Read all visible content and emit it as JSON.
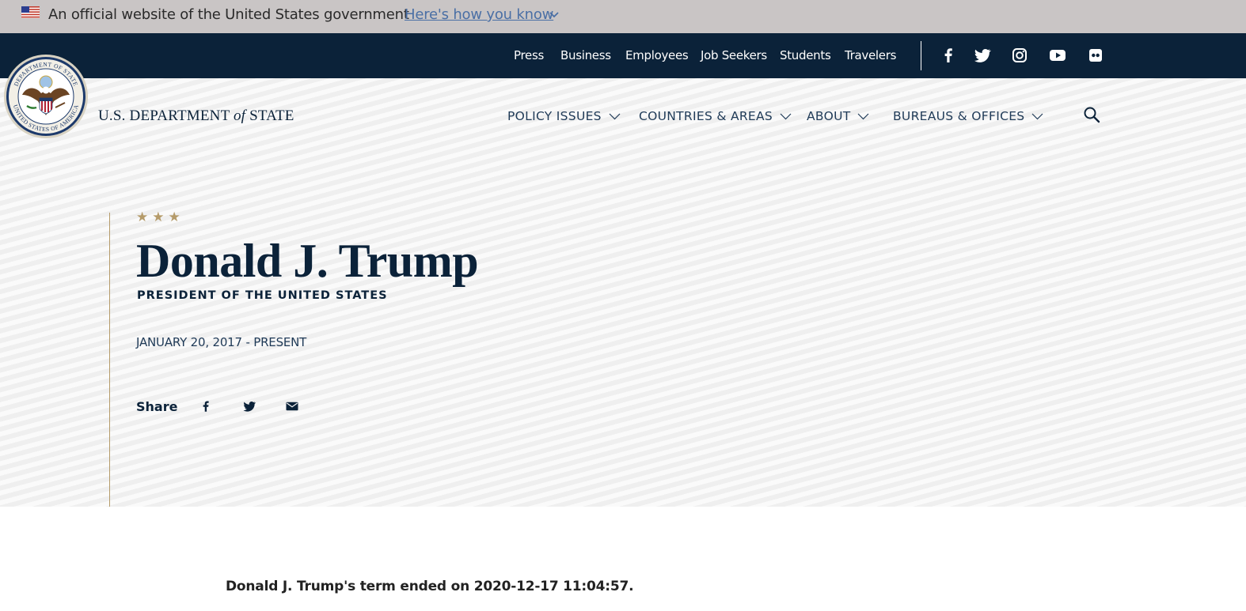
{
  "gov_banner": {
    "text": "An official website of the United States government",
    "link_text": "Here's how you know",
    "flag_icon": "us-flag-icon",
    "chevron_icon": "chevron-down-icon"
  },
  "utility_nav": {
    "links": [
      "Press",
      "Business",
      "Employees",
      "Job Seekers",
      "Students",
      "Travelers"
    ],
    "social_icons": [
      "facebook-icon",
      "twitter-icon",
      "instagram-icon",
      "youtube-icon",
      "flickr-icon"
    ]
  },
  "header": {
    "wordmark_prefix": "U.S. DEPARTMENT",
    "wordmark_of": "of",
    "wordmark_suffix": "STATE",
    "seal_text_top": "DEPARTMENT OF STATE",
    "seal_text_bottom": "UNITED STATES OF AMERICA",
    "nav": [
      "POLICY ISSUES",
      "COUNTRIES & AREAS",
      "ABOUT",
      "BUREAUS & OFFICES"
    ],
    "search_icon": "search-icon"
  },
  "hero": {
    "stars": "★★★",
    "title": "Donald J. Trump",
    "subtitle": "PRESIDENT OF THE UNITED STATES",
    "dates": "JANUARY 20, 2017 - PRESENT",
    "share_label": "Share",
    "share_icons": [
      "facebook-icon",
      "twitter-icon",
      "email-icon"
    ]
  },
  "body": {
    "term_text": "Donald J. Trump's term ended on 2020-12-17 11:04:57."
  },
  "colors": {
    "navy": "#0b2239",
    "gold": "#b59b6a",
    "banner_gray": "#c9c5c5",
    "link_blue": "#4a6fa5"
  }
}
